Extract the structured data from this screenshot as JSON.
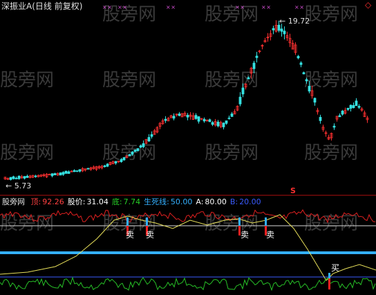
{
  "title": "深振业A(日线 前复权)",
  "s_marker": "S",
  "price_high_label": "19.72",
  "price_low_label": "5.73",
  "indicator": {
    "name": "股旁网",
    "items": [
      {
        "label": "顶:",
        "value": "92.26",
        "color": "#ff4040"
      },
      {
        "label": "股价:",
        "value": "31.04",
        "color": "#ffffff"
      },
      {
        "label": "底:",
        "value": "7.74",
        "color": "#27d027"
      },
      {
        "label": "生死线:",
        "value": "50.00",
        "color": "#34b0ff"
      },
      {
        "label": "A:",
        "value": "80.00",
        "color": "#ffffff"
      },
      {
        "label": "B:",
        "value": "20.00",
        "color": "#3a5bff"
      }
    ]
  },
  "signals": {
    "sell": [
      "卖",
      "卖",
      "卖",
      "卖"
    ],
    "buy": [
      "买"
    ]
  },
  "watermark": "股旁网",
  "marker_text": "× ×",
  "colors": {
    "up": "#ff3030",
    "down": "#35e0e0",
    "bg": "#000000",
    "midline": "#2d8cff"
  }
}
